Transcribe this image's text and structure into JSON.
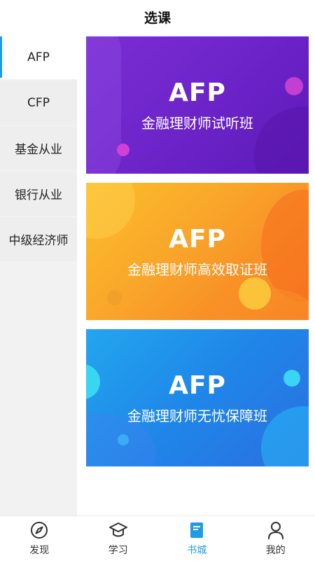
{
  "header": {
    "title": "选课"
  },
  "sidebar": {
    "items": [
      {
        "label": "AFP",
        "active": true
      },
      {
        "label": "CFP",
        "active": false
      },
      {
        "label": "基金从业",
        "active": false
      },
      {
        "label": "银行从业",
        "active": false
      },
      {
        "label": "中级经济师",
        "active": false
      }
    ]
  },
  "courses": [
    {
      "title": "AFP",
      "subtitle": "金融理财师试听班",
      "color": "#6a22c6"
    },
    {
      "title": "AFP",
      "subtitle": "金融理财师高效取证班",
      "color": "#f9a42a"
    },
    {
      "title": "AFP",
      "subtitle": "金融理财师无忧保障班",
      "color": "#1f86e8"
    }
  ],
  "tabbar": {
    "tabs": [
      {
        "label": "发现",
        "icon": "compass-icon",
        "active": false
      },
      {
        "label": "学习",
        "icon": "graduation-cap-icon",
        "active": false
      },
      {
        "label": "书城",
        "icon": "book-icon",
        "active": true
      },
      {
        "label": "我的",
        "icon": "user-icon",
        "active": false
      }
    ],
    "active_color": "#1e9be6"
  }
}
